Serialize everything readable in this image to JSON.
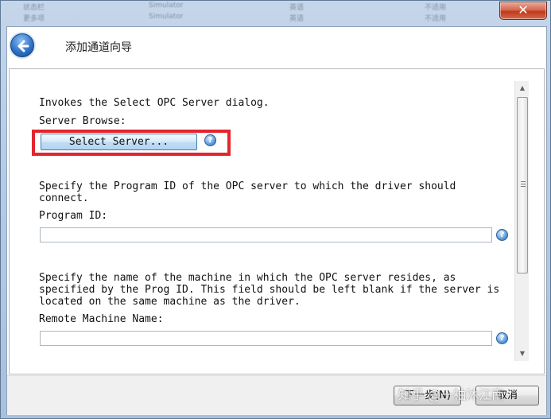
{
  "background_window": {
    "rows": [
      [
        "状态栏",
        "Simulator",
        "英语",
        "不适用"
      ],
      [
        "更多项",
        "Simulator",
        "英语",
        "不适用"
      ]
    ]
  },
  "window": {
    "close_label": "✕",
    "title": "添加通道向导"
  },
  "content": {
    "invokes_text": "Invokes the Select OPC Server dialog.",
    "server_browse_label": "Server Browse:",
    "select_server_button": "Select Server...",
    "program_id_description": "Specify the Program ID of the OPC server to which the driver should connect.",
    "program_id_label": "Program ID:",
    "program_id_value": "",
    "remote_description": "Specify the name of the machine in which the OPC server resides, as specified by the Prog ID. This field should be left blank if the server is located on the same machine as the driver.",
    "remote_machine_label": "Remote Machine Name:",
    "remote_machine_value": "",
    "help_glyph": "?"
  },
  "footer": {
    "next_button": "下一步(N)",
    "cancel_button": "取消"
  },
  "watermark": "知乎 @一袖沐江南",
  "colors": {
    "highlight_box": "#e2252e",
    "accent": "#2f74c9"
  },
  "icons": {
    "back": "back-arrow-icon",
    "help": "help-icon",
    "close": "close-icon"
  }
}
